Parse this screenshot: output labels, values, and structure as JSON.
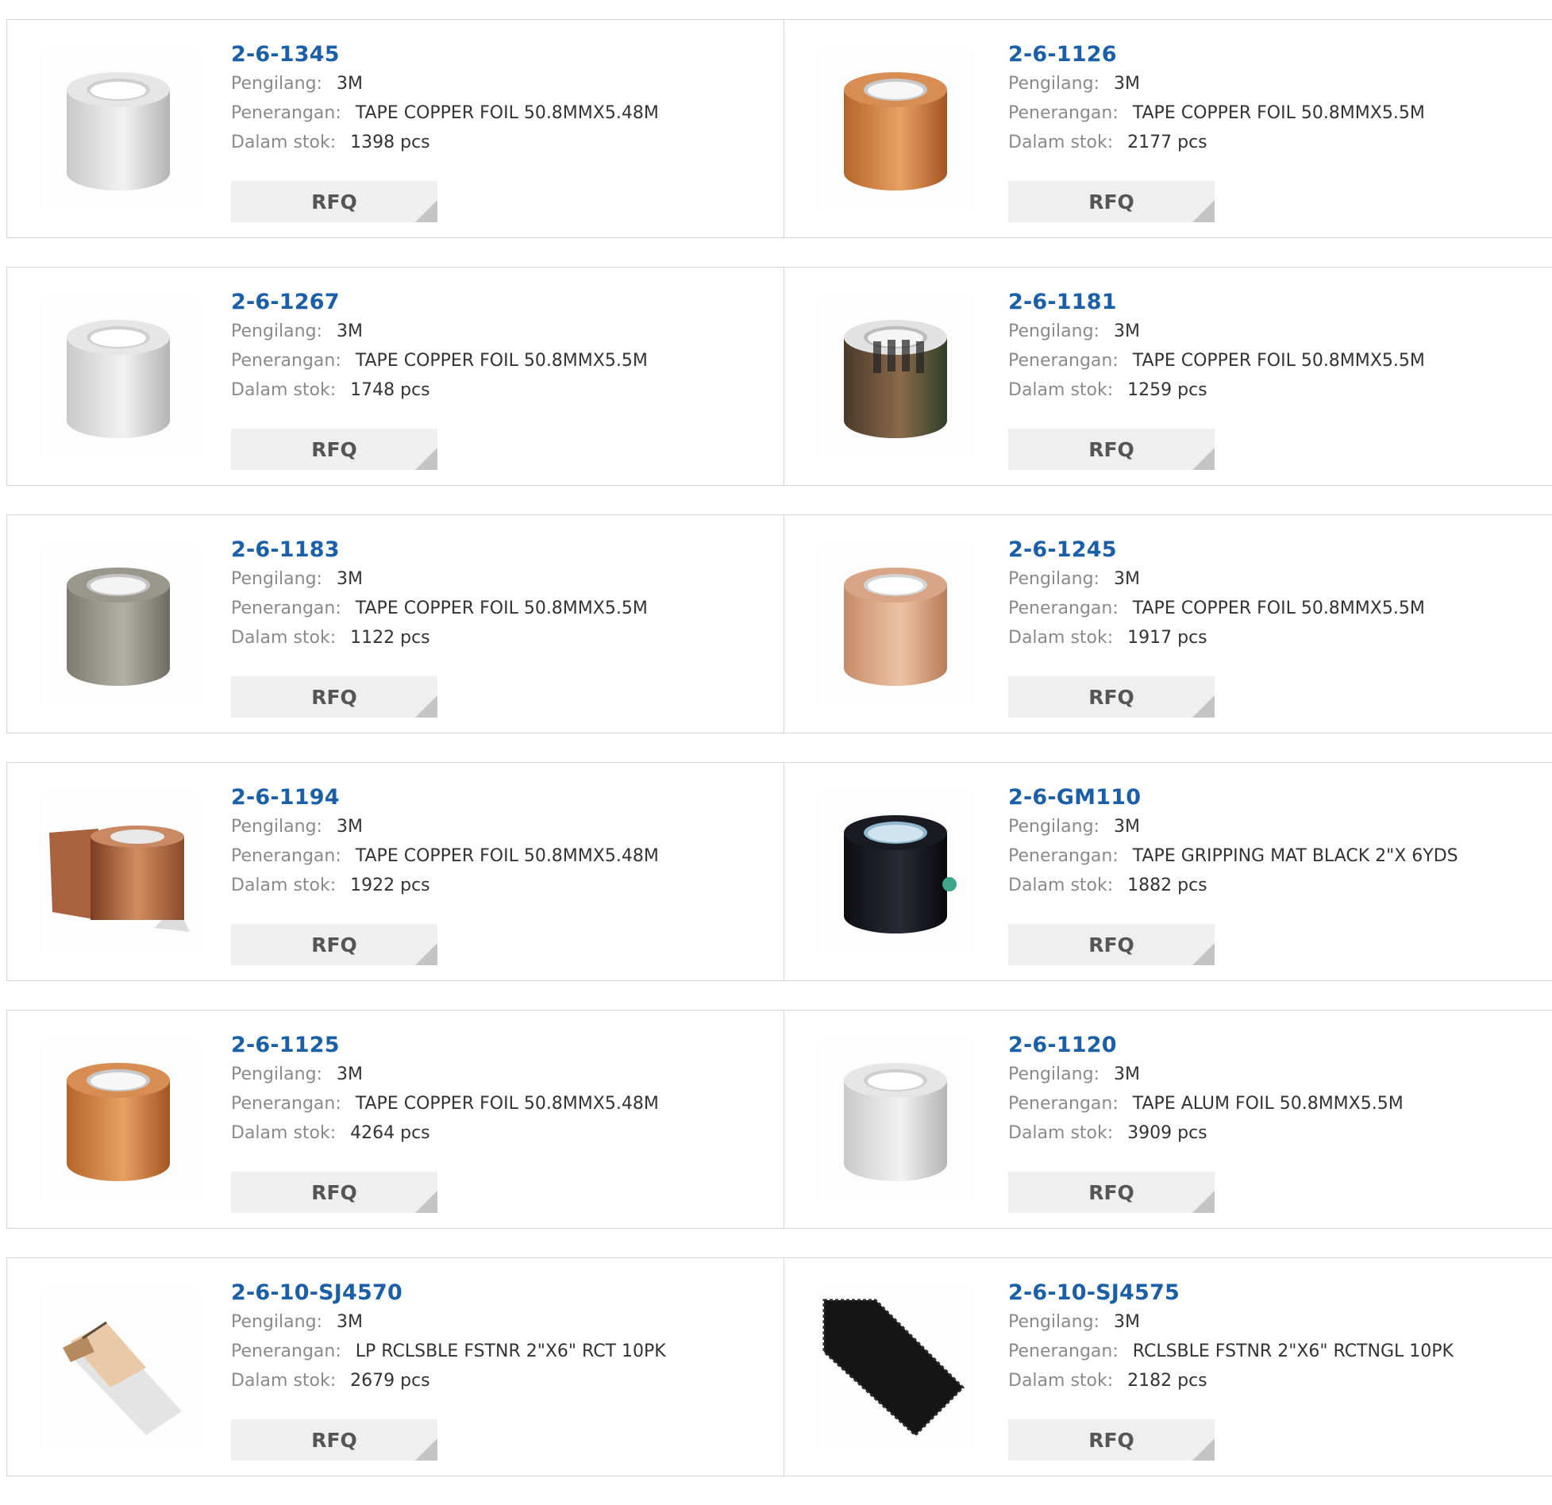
{
  "labels": {
    "manufacturer": "Pengilang:",
    "description": "Penerangan:",
    "stock": "Dalam stok:",
    "rfq": "RFQ"
  },
  "products": [
    {
      "part": "2-6-1345",
      "manufacturer": "3M",
      "description": "TAPE COPPER FOIL 50.8MMX5.48M",
      "stock": "1398 pcs",
      "image": "silver-tape-roll"
    },
    {
      "part": "2-6-1126",
      "manufacturer": "3M",
      "description": "TAPE COPPER FOIL 50.8MMX5.5M",
      "stock": "2177 pcs",
      "image": "copper-tape-roll"
    },
    {
      "part": "2-6-1267",
      "manufacturer": "3M",
      "description": "TAPE COPPER FOIL 50.8MMX5.5M",
      "stock": "1748 pcs",
      "image": "silver-tape-roll"
    },
    {
      "part": "2-6-1181",
      "manufacturer": "3M",
      "description": "TAPE COPPER FOIL 50.8MMX5.5M",
      "stock": "1259 pcs",
      "image": "dark-labeled-tape-roll"
    },
    {
      "part": "2-6-1183",
      "manufacturer": "3M",
      "description": "TAPE COPPER FOIL 50.8MMX5.5M",
      "stock": "1122 pcs",
      "image": "gray-tape-roll"
    },
    {
      "part": "2-6-1245",
      "manufacturer": "3M",
      "description": "TAPE COPPER FOIL 50.8MMX5.5M",
      "stock": "1917 pcs",
      "image": "light-copper-tape-roll"
    },
    {
      "part": "2-6-1194",
      "manufacturer": "3M",
      "description": "TAPE COPPER FOIL 50.8MMX5.48M",
      "stock": "1922 pcs",
      "image": "unrolled-copper-tape"
    },
    {
      "part": "2-6-GM110",
      "manufacturer": "3M",
      "description": "TAPE GRIPPING MAT BLACK 2\"X 6YDS",
      "stock": "1882 pcs",
      "image": "black-tape-roll"
    },
    {
      "part": "2-6-1125",
      "manufacturer": "3M",
      "description": "TAPE COPPER FOIL 50.8MMX5.48M",
      "stock": "4264 pcs",
      "image": "copper-tape-roll"
    },
    {
      "part": "2-6-1120",
      "manufacturer": "3M",
      "description": "TAPE ALUM FOIL 50.8MMX5.5M",
      "stock": "3909 pcs",
      "image": "silver-tape-roll"
    },
    {
      "part": "2-6-10-SJ4570",
      "manufacturer": "3M",
      "description": "LP RCLSBLE FSTNR 2\"X6\" RCT 10PK",
      "stock": "2679 pcs",
      "image": "fastener-strip"
    },
    {
      "part": "2-6-10-SJ4575",
      "manufacturer": "3M",
      "description": "RCLSBLE FSTNR 2\"X6\" RCTNGL 10PK",
      "stock": "2182 pcs",
      "image": "black-fastener-strip"
    }
  ],
  "colors": {
    "part_link": "#1a5fa8",
    "label": "#8a8a8a",
    "value": "#333333",
    "button_bg": "#efefef",
    "border": "#d4d4d4"
  }
}
